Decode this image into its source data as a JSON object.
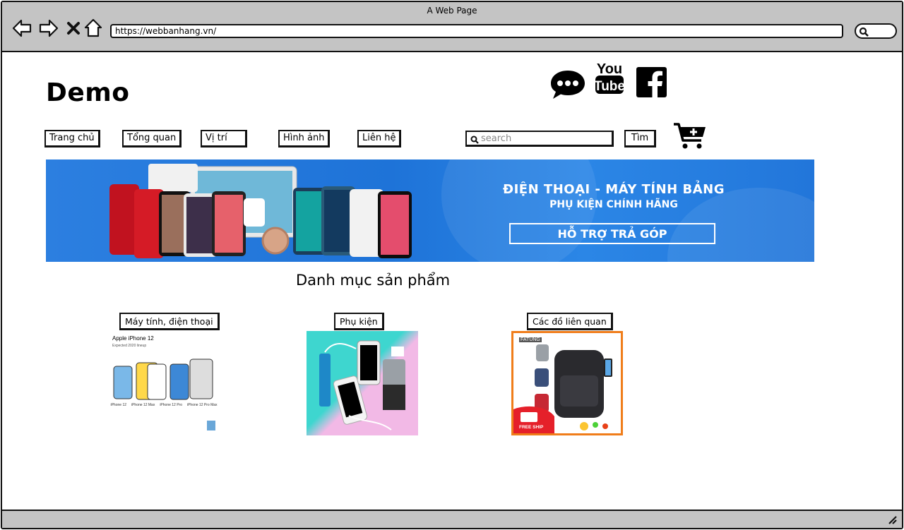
{
  "browser": {
    "window_title": "A Web Page",
    "url": "https://webbanhang.vn/"
  },
  "site": {
    "logo": "Demo"
  },
  "social": [
    {
      "icon": "chat-bubble-icon"
    },
    {
      "icon": "youtube-icon",
      "text_top": "You",
      "text_bottom": "Tube"
    },
    {
      "icon": "facebook-icon",
      "text": "f"
    }
  ],
  "nav": {
    "items": [
      {
        "label": "Trang chủ"
      },
      {
        "label": "Tổng quan"
      },
      {
        "label": "Vị trí"
      },
      {
        "label": "Hình ảnh"
      },
      {
        "label": "Liên hệ"
      }
    ]
  },
  "search": {
    "placeholder": "search",
    "button_label": "Tìm"
  },
  "banner": {
    "line1": "ĐIỆN THOẠI - MÁY TÍNH BẢNG",
    "line2": "PHỤ KIỆN CHÍNH HÃNG",
    "cta": "HỖ TRỢ TRẢ GÓP"
  },
  "catalog": {
    "title": "Danh mục sản phẩm",
    "categories": [
      {
        "label": "Máy tính, điện thoại",
        "image_text": {
          "heading": "Apple iPhone 12",
          "subheading": "Expected 2020 lineup",
          "models": [
            "iPhone 12",
            "iPhone 12 Max",
            "iPhone 12 Pro",
            "iPhone 12 Pro Max"
          ]
        }
      },
      {
        "label": "Phụ kiện"
      },
      {
        "label": "Các đồ liên quan",
        "image_text": {
          "brand": "FATUNG",
          "badge": "FREE SHIP"
        }
      }
    ]
  },
  "colors": {
    "chrome": "#c4c4c4",
    "banner_blue": "#2079dc",
    "accessory_bg": "#3ed6cf",
    "accessory_pink": "#f2b9e6",
    "orange_frame": "#f07d1a",
    "free_ship_red": "#e5202a"
  }
}
